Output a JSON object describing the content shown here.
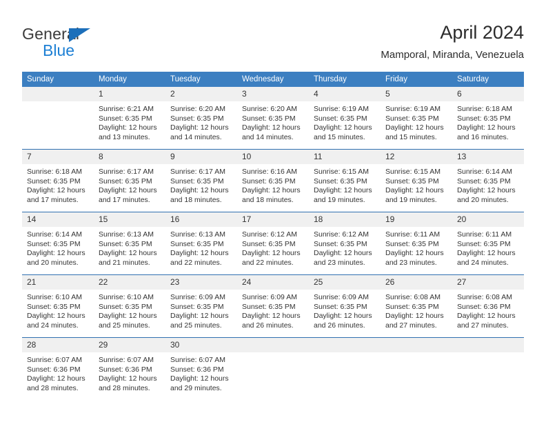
{
  "brand": {
    "name_top": "General",
    "name_bottom": "Blue",
    "accent_dark": "#1c6fba",
    "accent_light": "#1c7fd4"
  },
  "header": {
    "title": "April 2024",
    "subtitle": "Mamporal, Miranda, Venezuela"
  },
  "theme": {
    "header_blue": "#3c7fc1",
    "row_divider_blue": "#2f6fb0",
    "daynum_band": "#f0f0f0",
    "text": "#333333"
  },
  "weekday_headers": [
    "Sunday",
    "Monday",
    "Tuesday",
    "Wednesday",
    "Thursday",
    "Friday",
    "Saturday"
  ],
  "weeks": [
    [
      {
        "day": "",
        "sunrise": "",
        "sunset": "",
        "daylight_line1": "",
        "daylight_line2": ""
      },
      {
        "day": "1",
        "sunrise": "Sunrise: 6:21 AM",
        "sunset": "Sunset: 6:35 PM",
        "daylight_line1": "Daylight: 12 hours",
        "daylight_line2": "and 13 minutes."
      },
      {
        "day": "2",
        "sunrise": "Sunrise: 6:20 AM",
        "sunset": "Sunset: 6:35 PM",
        "daylight_line1": "Daylight: 12 hours",
        "daylight_line2": "and 14 minutes."
      },
      {
        "day": "3",
        "sunrise": "Sunrise: 6:20 AM",
        "sunset": "Sunset: 6:35 PM",
        "daylight_line1": "Daylight: 12 hours",
        "daylight_line2": "and 14 minutes."
      },
      {
        "day": "4",
        "sunrise": "Sunrise: 6:19 AM",
        "sunset": "Sunset: 6:35 PM",
        "daylight_line1": "Daylight: 12 hours",
        "daylight_line2": "and 15 minutes."
      },
      {
        "day": "5",
        "sunrise": "Sunrise: 6:19 AM",
        "sunset": "Sunset: 6:35 PM",
        "daylight_line1": "Daylight: 12 hours",
        "daylight_line2": "and 15 minutes."
      },
      {
        "day": "6",
        "sunrise": "Sunrise: 6:18 AM",
        "sunset": "Sunset: 6:35 PM",
        "daylight_line1": "Daylight: 12 hours",
        "daylight_line2": "and 16 minutes."
      }
    ],
    [
      {
        "day": "7",
        "sunrise": "Sunrise: 6:18 AM",
        "sunset": "Sunset: 6:35 PM",
        "daylight_line1": "Daylight: 12 hours",
        "daylight_line2": "and 17 minutes."
      },
      {
        "day": "8",
        "sunrise": "Sunrise: 6:17 AM",
        "sunset": "Sunset: 6:35 PM",
        "daylight_line1": "Daylight: 12 hours",
        "daylight_line2": "and 17 minutes."
      },
      {
        "day": "9",
        "sunrise": "Sunrise: 6:17 AM",
        "sunset": "Sunset: 6:35 PM",
        "daylight_line1": "Daylight: 12 hours",
        "daylight_line2": "and 18 minutes."
      },
      {
        "day": "10",
        "sunrise": "Sunrise: 6:16 AM",
        "sunset": "Sunset: 6:35 PM",
        "daylight_line1": "Daylight: 12 hours",
        "daylight_line2": "and 18 minutes."
      },
      {
        "day": "11",
        "sunrise": "Sunrise: 6:15 AM",
        "sunset": "Sunset: 6:35 PM",
        "daylight_line1": "Daylight: 12 hours",
        "daylight_line2": "and 19 minutes."
      },
      {
        "day": "12",
        "sunrise": "Sunrise: 6:15 AM",
        "sunset": "Sunset: 6:35 PM",
        "daylight_line1": "Daylight: 12 hours",
        "daylight_line2": "and 19 minutes."
      },
      {
        "day": "13",
        "sunrise": "Sunrise: 6:14 AM",
        "sunset": "Sunset: 6:35 PM",
        "daylight_line1": "Daylight: 12 hours",
        "daylight_line2": "and 20 minutes."
      }
    ],
    [
      {
        "day": "14",
        "sunrise": "Sunrise: 6:14 AM",
        "sunset": "Sunset: 6:35 PM",
        "daylight_line1": "Daylight: 12 hours",
        "daylight_line2": "and 20 minutes."
      },
      {
        "day": "15",
        "sunrise": "Sunrise: 6:13 AM",
        "sunset": "Sunset: 6:35 PM",
        "daylight_line1": "Daylight: 12 hours",
        "daylight_line2": "and 21 minutes."
      },
      {
        "day": "16",
        "sunrise": "Sunrise: 6:13 AM",
        "sunset": "Sunset: 6:35 PM",
        "daylight_line1": "Daylight: 12 hours",
        "daylight_line2": "and 22 minutes."
      },
      {
        "day": "17",
        "sunrise": "Sunrise: 6:12 AM",
        "sunset": "Sunset: 6:35 PM",
        "daylight_line1": "Daylight: 12 hours",
        "daylight_line2": "and 22 minutes."
      },
      {
        "day": "18",
        "sunrise": "Sunrise: 6:12 AM",
        "sunset": "Sunset: 6:35 PM",
        "daylight_line1": "Daylight: 12 hours",
        "daylight_line2": "and 23 minutes."
      },
      {
        "day": "19",
        "sunrise": "Sunrise: 6:11 AM",
        "sunset": "Sunset: 6:35 PM",
        "daylight_line1": "Daylight: 12 hours",
        "daylight_line2": "and 23 minutes."
      },
      {
        "day": "20",
        "sunrise": "Sunrise: 6:11 AM",
        "sunset": "Sunset: 6:35 PM",
        "daylight_line1": "Daylight: 12 hours",
        "daylight_line2": "and 24 minutes."
      }
    ],
    [
      {
        "day": "21",
        "sunrise": "Sunrise: 6:10 AM",
        "sunset": "Sunset: 6:35 PM",
        "daylight_line1": "Daylight: 12 hours",
        "daylight_line2": "and 24 minutes."
      },
      {
        "day": "22",
        "sunrise": "Sunrise: 6:10 AM",
        "sunset": "Sunset: 6:35 PM",
        "daylight_line1": "Daylight: 12 hours",
        "daylight_line2": "and 25 minutes."
      },
      {
        "day": "23",
        "sunrise": "Sunrise: 6:09 AM",
        "sunset": "Sunset: 6:35 PM",
        "daylight_line1": "Daylight: 12 hours",
        "daylight_line2": "and 25 minutes."
      },
      {
        "day": "24",
        "sunrise": "Sunrise: 6:09 AM",
        "sunset": "Sunset: 6:35 PM",
        "daylight_line1": "Daylight: 12 hours",
        "daylight_line2": "and 26 minutes."
      },
      {
        "day": "25",
        "sunrise": "Sunrise: 6:09 AM",
        "sunset": "Sunset: 6:35 PM",
        "daylight_line1": "Daylight: 12 hours",
        "daylight_line2": "and 26 minutes."
      },
      {
        "day": "26",
        "sunrise": "Sunrise: 6:08 AM",
        "sunset": "Sunset: 6:35 PM",
        "daylight_line1": "Daylight: 12 hours",
        "daylight_line2": "and 27 minutes."
      },
      {
        "day": "27",
        "sunrise": "Sunrise: 6:08 AM",
        "sunset": "Sunset: 6:36 PM",
        "daylight_line1": "Daylight: 12 hours",
        "daylight_line2": "and 27 minutes."
      }
    ],
    [
      {
        "day": "28",
        "sunrise": "Sunrise: 6:07 AM",
        "sunset": "Sunset: 6:36 PM",
        "daylight_line1": "Daylight: 12 hours",
        "daylight_line2": "and 28 minutes."
      },
      {
        "day": "29",
        "sunrise": "Sunrise: 6:07 AM",
        "sunset": "Sunset: 6:36 PM",
        "daylight_line1": "Daylight: 12 hours",
        "daylight_line2": "and 28 minutes."
      },
      {
        "day": "30",
        "sunrise": "Sunrise: 6:07 AM",
        "sunset": "Sunset: 6:36 PM",
        "daylight_line1": "Daylight: 12 hours",
        "daylight_line2": "and 29 minutes."
      },
      {
        "day": "",
        "sunrise": "",
        "sunset": "",
        "daylight_line1": "",
        "daylight_line2": ""
      },
      {
        "day": "",
        "sunrise": "",
        "sunset": "",
        "daylight_line1": "",
        "daylight_line2": ""
      },
      {
        "day": "",
        "sunrise": "",
        "sunset": "",
        "daylight_line1": "",
        "daylight_line2": ""
      },
      {
        "day": "",
        "sunrise": "",
        "sunset": "",
        "daylight_line1": "",
        "daylight_line2": ""
      }
    ]
  ]
}
